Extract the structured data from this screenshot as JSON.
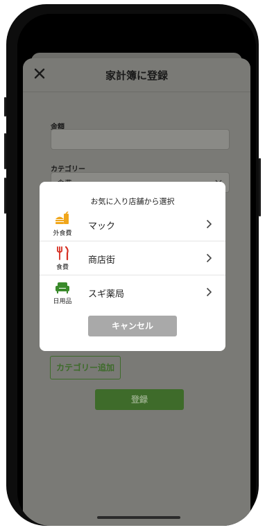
{
  "header": {
    "title": "家計簿に登録"
  },
  "form": {
    "amount_label": "金額",
    "amount_value": "",
    "category_label": "カテゴリー",
    "category_value": "食費",
    "add_category_label": "カテゴリー追加",
    "register_label": "登録"
  },
  "modal": {
    "title": "お気に入り店舗から選択",
    "shops": [
      {
        "icon": "burger-drink-icon",
        "category": "外食費",
        "name": "マック",
        "color": "#f0a61a"
      },
      {
        "icon": "fork-knife-icon",
        "category": "食費",
        "name": "商店街",
        "color": "#d62d20"
      },
      {
        "icon": "sofa-icon",
        "category": "日用品",
        "name": "スギ薬局",
        "color": "#3a8a2b"
      }
    ],
    "cancel_label": "キャンセル"
  },
  "colors": {
    "accent_green": "#3e6b2a",
    "overlay": "#7a7a76",
    "cancel_gray": "#a9a9a9"
  }
}
